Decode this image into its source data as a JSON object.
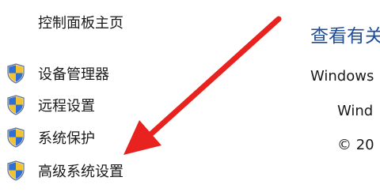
{
  "sidebar": {
    "home_label": "控制面板主页",
    "items": [
      {
        "label": "设备管理器",
        "icon": "uac-shield-icon"
      },
      {
        "label": "远程设置",
        "icon": "uac-shield-icon"
      },
      {
        "label": "系统保护",
        "icon": "uac-shield-icon"
      },
      {
        "label": "高级系统设置",
        "icon": "uac-shield-icon"
      }
    ]
  },
  "main": {
    "title": "查看有关",
    "section_heading": "Windows",
    "edition_value": "Wind",
    "copyright_value": "© 20"
  },
  "annotation": {
    "arrow_color": "#e8231f",
    "points_to": "高级系统设置"
  },
  "colors": {
    "title": "#1f4e99",
    "text": "#1a1a1a",
    "shield_blue": "#2f6fd4",
    "shield_yellow": "#f2c230"
  }
}
